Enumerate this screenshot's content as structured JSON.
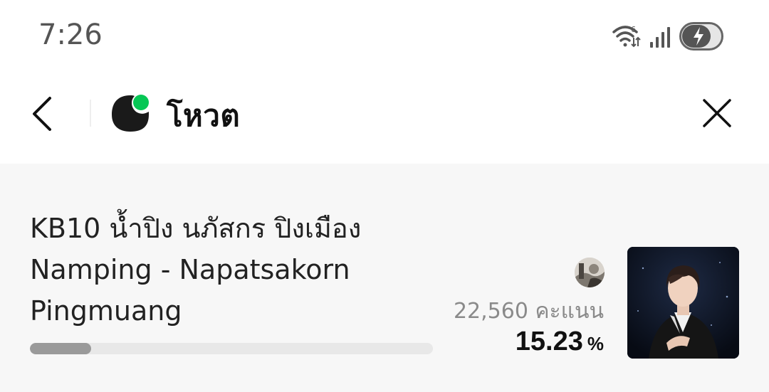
{
  "status_bar": {
    "time": "7:26",
    "icons": [
      "wifi-6-icon",
      "signal-icon",
      "battery-charging-icon"
    ]
  },
  "header": {
    "title": "โหวต",
    "back_icon": "chevron-left-icon",
    "logo_icon": "brand-logo-icon",
    "close_icon": "close-icon",
    "brand_colors": {
      "logo_dark": "#1a1a1a",
      "logo_accent": "#06c755"
    }
  },
  "candidate": {
    "name_lines": [
      "KB10 น้ำปิง นภัสกร ปิงเมือง",
      "Namping - Napatsakorn",
      "Pingmuang"
    ],
    "votes_label": "22,560 คะแนน",
    "percent_value": "15.23",
    "percent_sign": "%",
    "progress_fraction": 0.1523,
    "progress_color": "#9a9a9a"
  }
}
